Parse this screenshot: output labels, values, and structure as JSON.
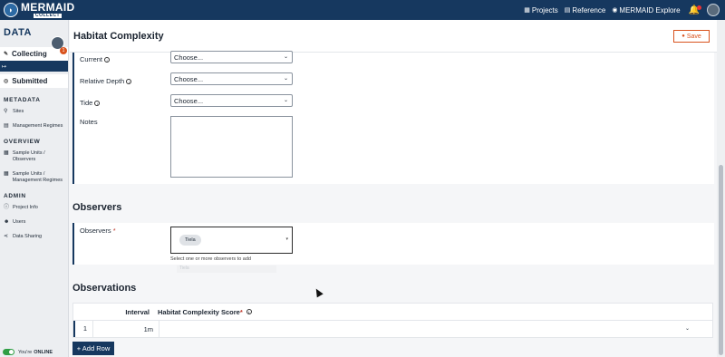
{
  "brand": {
    "name": "MERMAID",
    "sub": "COLLECT"
  },
  "topnav": {
    "projects": "Projects",
    "reference": "Reference",
    "explore": "MERMAID Explore"
  },
  "sidebar": {
    "title": "DATA",
    "badge_count": "1",
    "collecting": "Collecting",
    "submitted": "Submitted",
    "strip": "↦",
    "sections": {
      "metadata": "METADATA",
      "overview": "OVERVIEW",
      "admin": "ADMIN"
    },
    "metadata_items": [
      "Sites",
      "Management Regimes"
    ],
    "overview_items": [
      "Sample Units / Observers",
      "Sample Units / Management Regimes"
    ],
    "admin_items": [
      "Project Info",
      "Users",
      "Data Sharing"
    ],
    "status_prefix": "You're",
    "status_value": "ONLINE"
  },
  "header": {
    "title": "Habitat Complexity",
    "save": "Save"
  },
  "form": {
    "current": {
      "label": "Current",
      "value": "Choose..."
    },
    "relative_depth": {
      "label": "Relative Depth",
      "value": "Choose..."
    },
    "tide": {
      "label": "Tide",
      "value": "Choose..."
    },
    "notes": {
      "label": "Notes",
      "value": ""
    }
  },
  "observers": {
    "title": "Observers",
    "label": "Observers",
    "required": "*",
    "chip": "Tiela",
    "helper": "Select one or more observers to add",
    "ghost": "Tiela"
  },
  "observations": {
    "title": "Observations",
    "columns": {
      "interval": "Interval",
      "score": "Habitat Complexity Score",
      "required": "*"
    },
    "rows": [
      {
        "num": "1",
        "interval": "1m",
        "score": ""
      }
    ],
    "add_row": "+ Add Row"
  },
  "colors": {
    "navy": "#16385f",
    "accent": "#d9531e",
    "online": "#2f9e44"
  }
}
